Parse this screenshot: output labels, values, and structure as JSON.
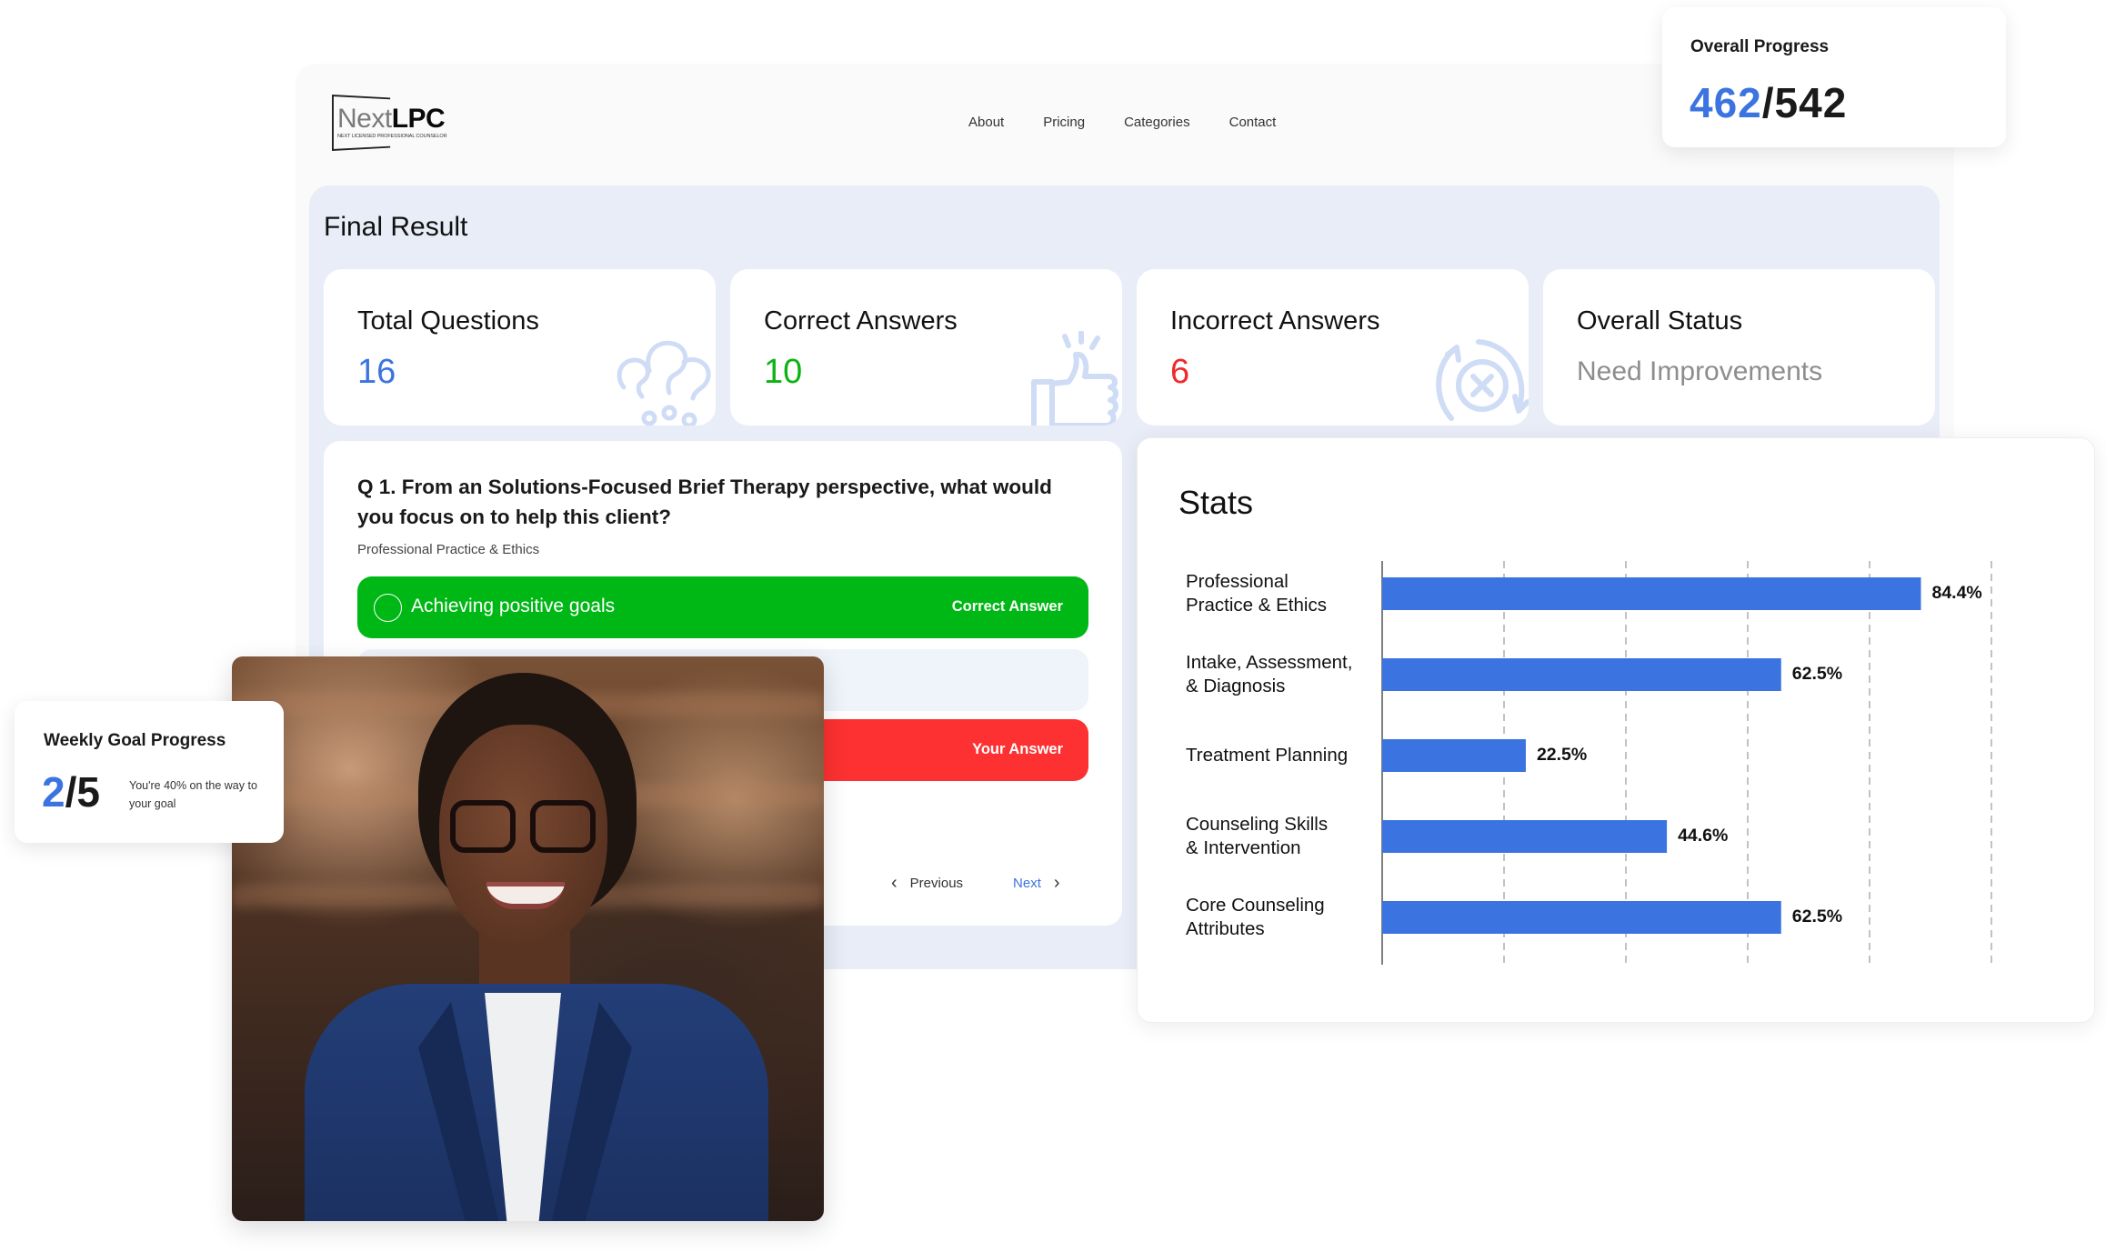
{
  "brand": {
    "name_light": "Next",
    "name_bold": "LPC",
    "tagline": "NEXT LICENSED PROFESSIONAL COUNSELOR"
  },
  "nav": [
    {
      "label": "About"
    },
    {
      "label": "Pricing"
    },
    {
      "label": "Categories"
    },
    {
      "label": "Contact"
    }
  ],
  "overall_progress": {
    "title": "Overall Progress",
    "completed": "462",
    "separator": "/",
    "total": "542"
  },
  "final_result": {
    "title": "Final Result",
    "cards": [
      {
        "label": "Total Questions",
        "value": "16",
        "icon": "question-cloud-icon",
        "color": "#3b74e0"
      },
      {
        "label": "Correct Answers",
        "value": "10",
        "icon": "thumbs-up-icon",
        "color": "#0cb313"
      },
      {
        "label": "Incorrect Answers",
        "value": "6",
        "icon": "retry-x-icon",
        "color": "#f02a2a"
      },
      {
        "label": "Overall Status",
        "value": "Need Improvements",
        "icon": null,
        "color": "#8d8d8d"
      }
    ]
  },
  "question": {
    "text": "Q 1. From an Solutions-Focused Brief Therapy perspective, what would you focus on to help this client?",
    "category": "Professional Practice & Ethics",
    "options": [
      {
        "text": "Achieving positive goals",
        "tag": "Correct Answer",
        "state": "correct"
      },
      {
        "text": "",
        "tag": "",
        "state": "neutral"
      },
      {
        "text": "",
        "tag": "Your Answer",
        "state": "wrong"
      }
    ],
    "prev_label": "Previous",
    "next_label": "Next"
  },
  "weekly_goal": {
    "title": "Weekly Goal Progress",
    "completed": "2",
    "separator": "/",
    "total": "5",
    "subtitle": "You're 40% on the way to your goal",
    "percent": 40
  },
  "colors": {
    "accent": "#3b74e0",
    "correct": "#00b815",
    "wrong": "#fd3131",
    "bar": "#3b74e0"
  },
  "chart_data": {
    "type": "bar",
    "orientation": "horizontal",
    "title": "Stats",
    "categories": [
      "Professional\nPractice & Ethics",
      "Intake, Assessment,\n& Diagnosis",
      "Treatment Planning",
      "Counseling Skills\n& Intervention",
      "Core Counseling\nAttributes"
    ],
    "values": [
      84.4,
      62.5,
      22.5,
      44.6,
      62.5
    ],
    "value_labels": [
      "84.4%",
      "62.5%",
      "22.5%",
      "44.6%",
      "62.5%"
    ],
    "xlabel": "",
    "ylabel": "",
    "xlim": [
      0,
      100
    ],
    "grid": "vertical-dashed",
    "gridlines": 5
  }
}
